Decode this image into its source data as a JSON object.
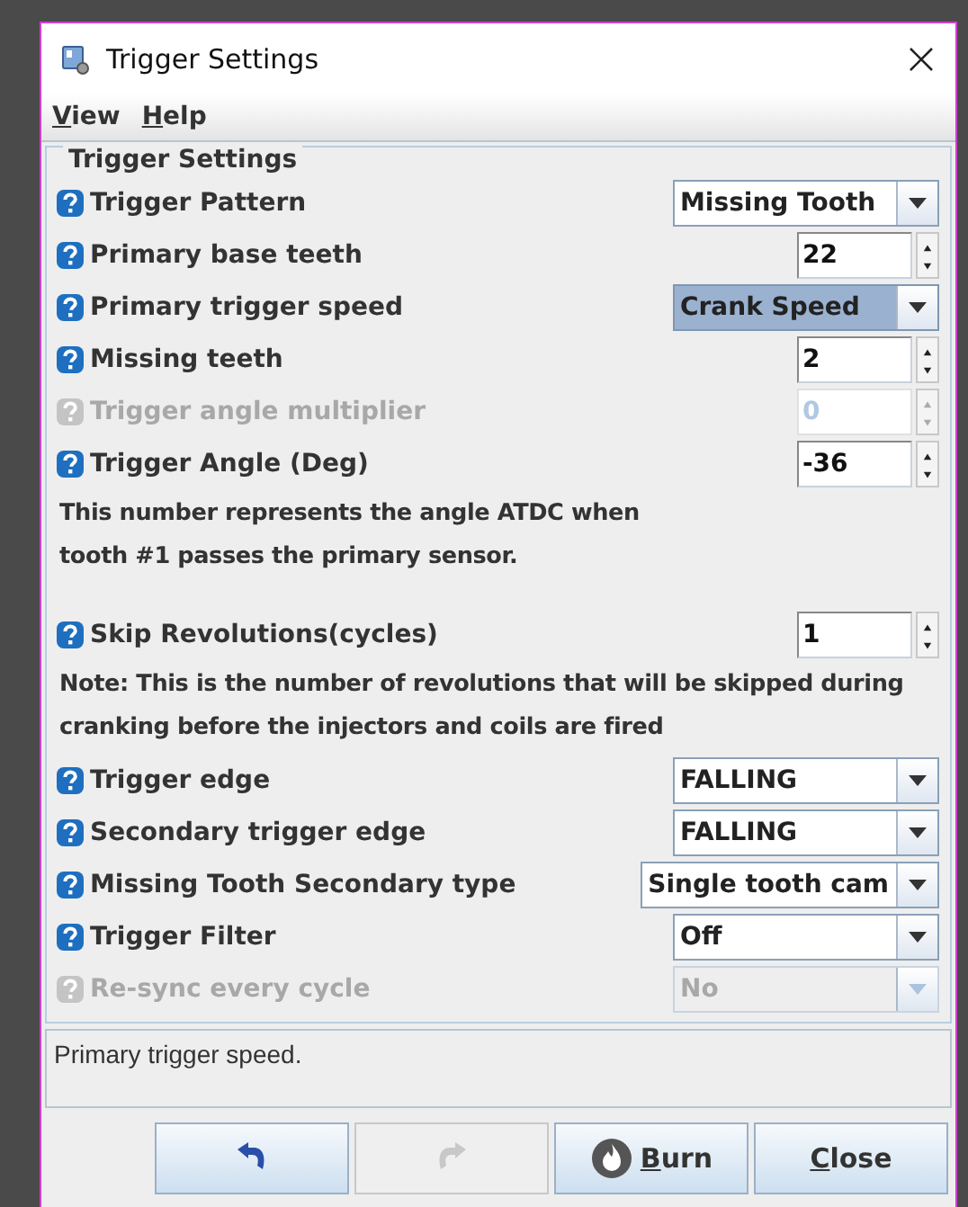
{
  "window": {
    "title": "Trigger Settings"
  },
  "menu": [
    {
      "label": "View"
    },
    {
      "label": "Help"
    }
  ],
  "panel": {
    "title": "Trigger Settings",
    "rows": [
      {
        "kind": "combo",
        "label": "Trigger Pattern",
        "value": "Missing Tooth",
        "disabled": false,
        "focused": false
      },
      {
        "kind": "spinner",
        "label": "Primary base teeth",
        "value": "22",
        "disabled": false
      },
      {
        "kind": "combo",
        "label": "Primary trigger speed",
        "value": "Crank Speed",
        "disabled": false,
        "focused": true
      },
      {
        "kind": "spinner",
        "label": "Missing teeth",
        "value": "2",
        "disabled": false
      },
      {
        "kind": "spinner",
        "label": "Trigger angle multiplier",
        "value": "0",
        "disabled": true
      },
      {
        "kind": "spinner",
        "label": "Trigger Angle (Deg)",
        "value": "-36",
        "disabled": false
      },
      {
        "kind": "note",
        "lines": [
          "This number represents the angle ATDC when",
          "tooth #1 passes the primary sensor."
        ]
      },
      {
        "kind": "gap"
      },
      {
        "kind": "spinner",
        "label": "Skip Revolutions(cycles)",
        "value": "1",
        "disabled": false
      },
      {
        "kind": "note",
        "lines": [
          "Note: This is the number of revolutions that will be skipped during",
          "cranking before the injectors and coils are fired"
        ]
      },
      {
        "kind": "combo",
        "label": "Trigger edge",
        "value": "FALLING",
        "disabled": false,
        "focused": false
      },
      {
        "kind": "combo",
        "label": "Secondary trigger edge",
        "value": "FALLING",
        "disabled": false,
        "focused": false
      },
      {
        "kind": "combo",
        "label": "Missing Tooth Secondary type",
        "value": "Single tooth cam",
        "disabled": false,
        "focused": false
      },
      {
        "kind": "combo",
        "label": "Trigger Filter",
        "value": "Off",
        "disabled": false,
        "focused": false
      },
      {
        "kind": "combo",
        "label": "Re-sync every cycle",
        "value": "No",
        "disabled": true,
        "focused": false
      }
    ]
  },
  "status": "Primary trigger speed.",
  "buttons": [
    {
      "kind": "undo",
      "disabled": false
    },
    {
      "kind": "redo",
      "disabled": true
    },
    {
      "kind": "burn",
      "label": "Burn",
      "disabled": false
    },
    {
      "kind": "close",
      "label": "Close",
      "disabled": false
    }
  ]
}
